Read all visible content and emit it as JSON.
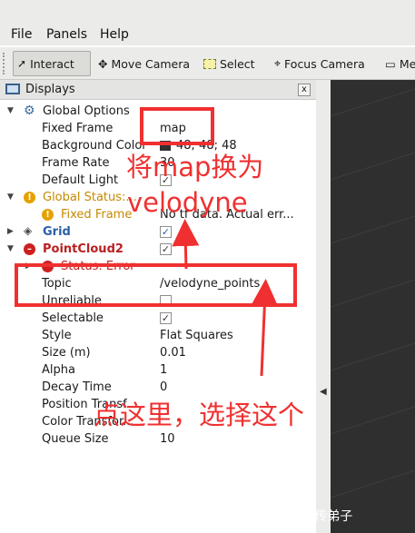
{
  "menu": [
    "File",
    "Panels",
    "Help"
  ],
  "toolbar": {
    "interact": "Interact",
    "move_camera": "Move Camera",
    "select": "Select",
    "focus_camera": "Focus Camera",
    "more": "Me"
  },
  "panel": {
    "title": "Displays",
    "close": "x"
  },
  "tree": {
    "global_options": "Global Options",
    "fixed_frame_label": "Fixed Frame",
    "fixed_frame_value": "map",
    "background_color_label": "Background Color",
    "background_color_value": "48; 48; 48",
    "frame_rate_label": "Frame Rate",
    "frame_rate_value": "30",
    "default_light_label": "Default Light",
    "global_status": "Global Status:...",
    "fixed_frame_status": "Fixed Frame",
    "fixed_frame_status_value": "No tf data.  Actual err...",
    "grid": "Grid",
    "pointcloud2": "PointCloud2",
    "status_error": "Status: Error",
    "topic_label": "Topic",
    "topic_value": "/velodyne_points",
    "unreliable_label": "Unreliable",
    "selectable_label": "Selectable",
    "style_label": "Style",
    "style_value": "Flat Squares",
    "size_label": "Size (m)",
    "size_value": "0.01",
    "alpha_label": "Alpha",
    "alpha_value": "1",
    "decay_label": "Decay Time",
    "decay_value": "0",
    "position_label": "Position Transf...",
    "color_label": "Color Transfor...",
    "queue_label": "Queue Size",
    "queue_value": "10"
  },
  "annotations": {
    "replace_line1": "将map换为",
    "replace_line2": "velodyne",
    "click_here": "点这里，选择这个"
  },
  "watermark": "CSDN @吴恩达亲传弟子",
  "colors": {
    "annotation_red": "#f03030",
    "viewport_bg": "#2f2f2f",
    "warning": "#c58a00",
    "error": "#b82020"
  }
}
